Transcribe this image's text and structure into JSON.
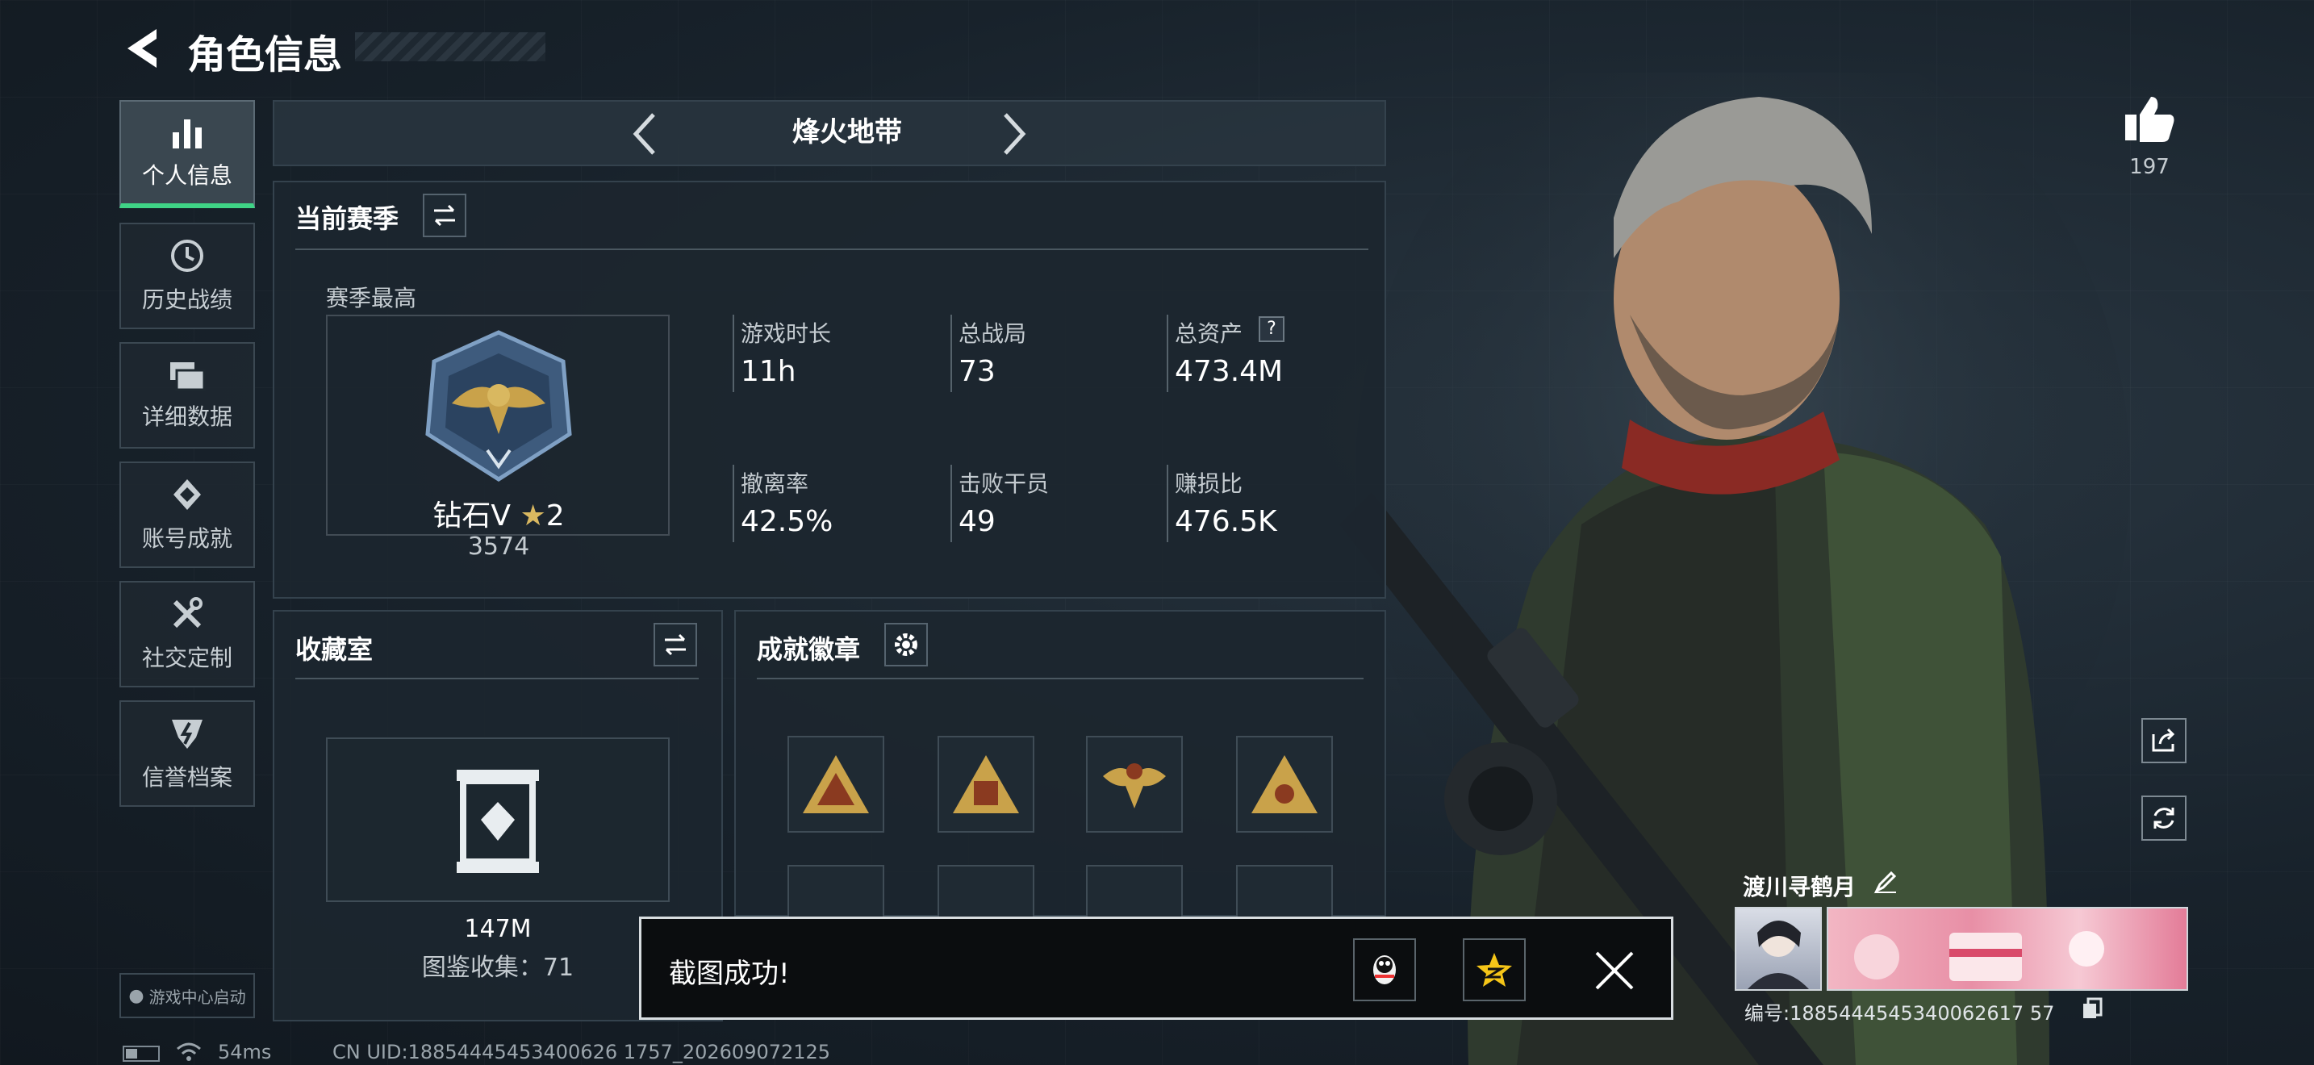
{
  "header": {
    "title": "角色信息"
  },
  "sidebar": {
    "items": [
      {
        "label": "个人信息",
        "icon": "bar-chart-icon",
        "active": true
      },
      {
        "label": "历史战绩",
        "icon": "history-clock-icon"
      },
      {
        "label": "详细数据",
        "icon": "folder-icon"
      },
      {
        "label": "账号成就",
        "icon": "achievement-icon"
      },
      {
        "label": "社交定制",
        "icon": "tools-icon"
      },
      {
        "label": "信誉档案",
        "icon": "credit-icon"
      }
    ],
    "game_center": "游戏中心启动"
  },
  "mode_selector": {
    "label": "烽火地带"
  },
  "season": {
    "title": "当前赛季",
    "best_label": "赛季最高",
    "rank": "钻石V",
    "stars": "2",
    "score": "3574",
    "stats": [
      {
        "label": "游戏时长",
        "value": "11h"
      },
      {
        "label": "总战局",
        "value": "73"
      },
      {
        "label": "总资产",
        "value": "473.4M"
      },
      {
        "label": "撤离率",
        "value": "42.5%"
      },
      {
        "label": "击败干员",
        "value": "49"
      },
      {
        "label": "赚损比",
        "value": "476.5K"
      }
    ],
    "help": "?"
  },
  "collection": {
    "title": "收藏室",
    "value": "147M",
    "catalog": "图鉴收集：71"
  },
  "badges": {
    "title": "成就徽章"
  },
  "likes": {
    "count": "197"
  },
  "profile": {
    "name": "渡川寻鹤月",
    "id": "编号:1885444545340062617 57"
  },
  "toast": {
    "message": "截图成功!"
  },
  "status_bar": {
    "ping": "54ms",
    "uid": "CN UID:18854445453400626 1757_202609072125"
  },
  "colors": {
    "accent": "#3fd486",
    "panel": "#1c262f",
    "gold": "#c9a24a"
  }
}
